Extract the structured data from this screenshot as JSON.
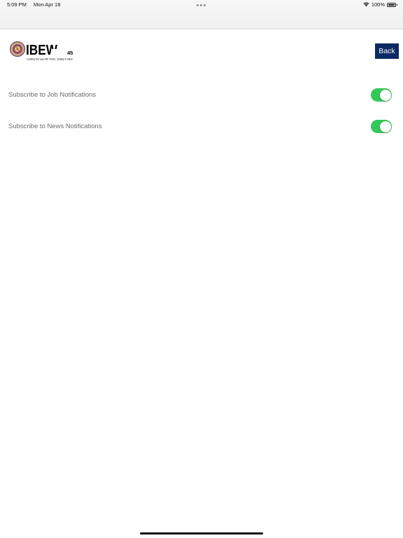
{
  "status_bar": {
    "time": "5:09 PM",
    "date": "Mon Apr 18",
    "battery": "100%"
  },
  "header": {
    "logo_text": "IBEW",
    "logo_local": "45",
    "logo_tagline": "Leading the way with Vision, Quality & Value",
    "back_label": "Back"
  },
  "settings": [
    {
      "label": "Subscribe to Job Notifications",
      "enabled": true
    },
    {
      "label": "Subscribe to News Notifications",
      "enabled": true
    }
  ],
  "colors": {
    "accent": "#0b2a63",
    "toggle_on": "#34c759"
  }
}
